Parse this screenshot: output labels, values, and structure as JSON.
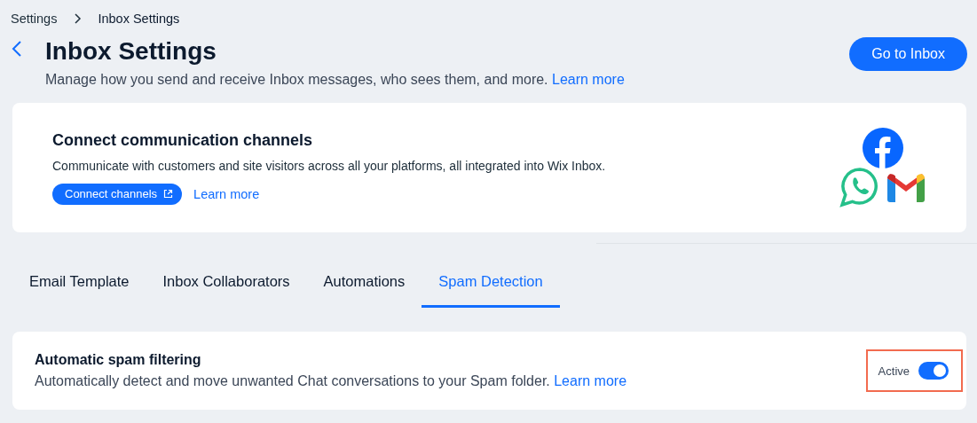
{
  "breadcrumb": [
    {
      "label": "Settings",
      "current": false
    },
    {
      "label": "Inbox Settings",
      "current": true
    }
  ],
  "header": {
    "title": "Inbox Settings",
    "subtitle": "Manage how you send and receive Inbox messages, who sees them, and more.",
    "subtitle_link": "Learn more",
    "action": "Go to Inbox"
  },
  "channels_card": {
    "title": "Connect communication channels",
    "description": "Communicate with customers and site visitors across all your platforms, all integrated into Wix Inbox.",
    "button": "Connect channels",
    "link": "Learn more"
  },
  "tabs": [
    {
      "label": "Email Template",
      "selected": false
    },
    {
      "label": "Inbox Collaborators",
      "selected": false
    },
    {
      "label": "Automations",
      "selected": false
    },
    {
      "label": "Spam Detection",
      "selected": true
    }
  ],
  "setting": {
    "title": "Automatic spam filtering",
    "description": "Automatically detect and move unwanted Chat conversations to your Spam folder.",
    "link": "Learn more",
    "status": "Active",
    "on": true,
    "highlighted": true
  }
}
